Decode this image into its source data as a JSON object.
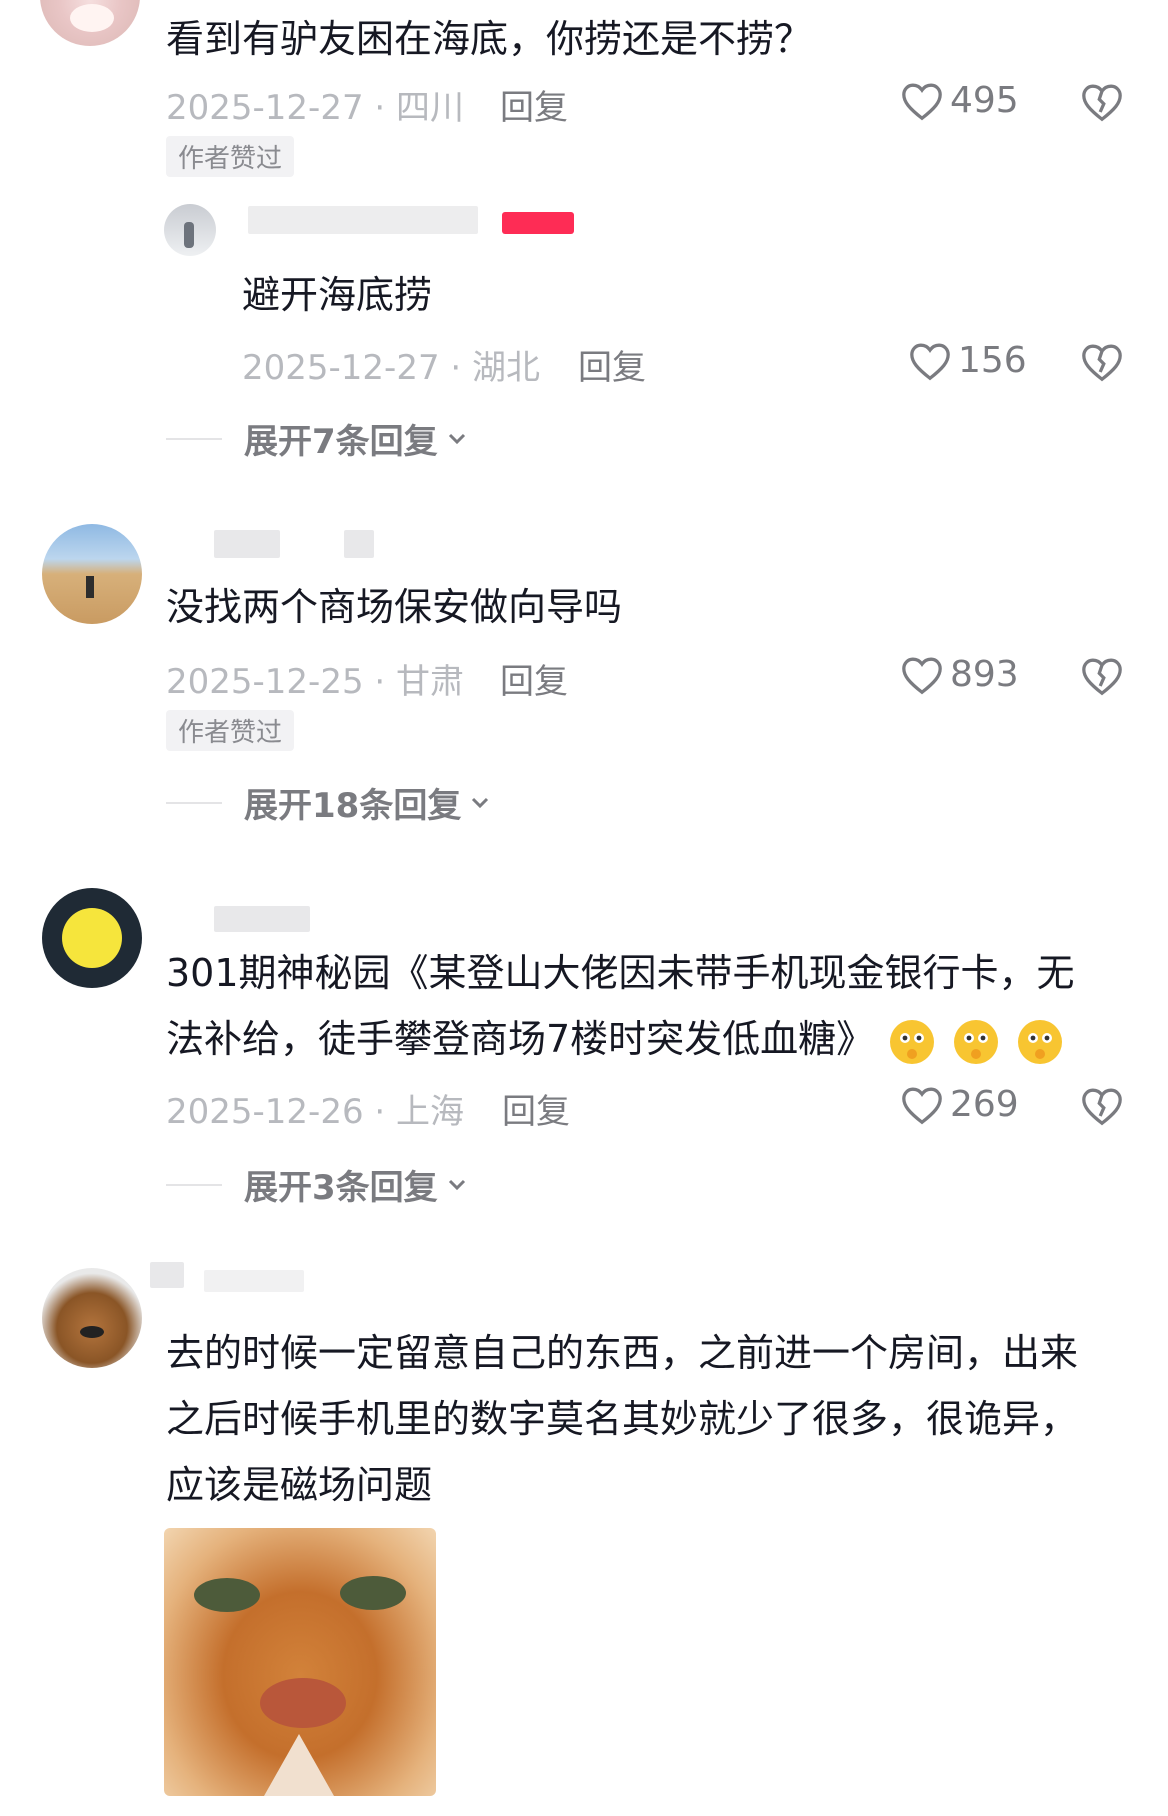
{
  "comments": [
    {
      "text": "看到有驴友困在海底，你捞还是不捞？",
      "meta": "2025-12-27 · 四川",
      "reply_label": "回复",
      "likes": "495",
      "badge": "作者赞过",
      "sub_reply": {
        "text": "避开海底捞",
        "meta": "2025-12-27 · 湖北",
        "reply_label": "回复",
        "likes": "156"
      },
      "expand": "展开7条回复"
    },
    {
      "text": "没找两个商场保安做向导吗",
      "meta": "2025-12-25 · 甘肃",
      "reply_label": "回复",
      "likes": "893",
      "badge": "作者赞过",
      "expand": "展开18条回复"
    },
    {
      "text_line1": "301期神秘园《某登山大佬因未带手机现金银行卡，无",
      "text_line2": "法补给，徒手攀登商场7楼时突发低血糖》",
      "meta": "2025-12-26 · 上海",
      "reply_label": "回复",
      "likes": "269",
      "expand": "展开3条回复"
    },
    {
      "text_line1": "去的时候一定留意自己的东西，之前进一个房间，出来",
      "text_line2": "之后时候手机里的数字莫名其妙就少了很多，很诡异，",
      "text_line3": "应该是磁场问题"
    }
  ],
  "colors": {
    "text": "#161823",
    "meta": "#b7b9be",
    "action": "#7a7b80",
    "badge_bg": "#f2f2f4",
    "author_tag": "#fe2c55"
  },
  "icons": {
    "like": "heart-outline-icon",
    "dislike": "broken-heart-icon",
    "expand": "chevron-down-icon",
    "emoji": "thinking-face-emoji"
  }
}
